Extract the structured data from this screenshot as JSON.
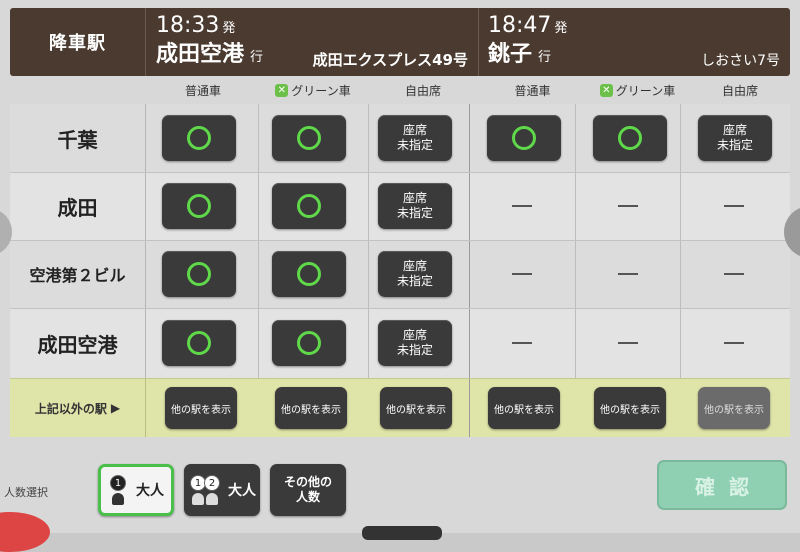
{
  "header": {
    "station_label": "降車駅",
    "train_a": {
      "time": "18:33",
      "time_suffix": "発",
      "dest": "成田空港",
      "dest_suffix": "行",
      "name": "成田エクスプレス49号"
    },
    "train_b": {
      "time": "18:47",
      "time_suffix": "発",
      "dest": "銚子",
      "dest_suffix": "行",
      "name": "しおさい7号"
    }
  },
  "classes": {
    "a": [
      "普通車",
      "グリーン車",
      "自由席"
    ],
    "b": [
      "普通車",
      "グリーン車",
      "自由席"
    ],
    "green_icon": "green-car-icon"
  },
  "stations": [
    {
      "name": "千葉",
      "a": [
        "available",
        "available",
        "unreserved"
      ],
      "b": [
        "available",
        "available",
        "unreserved"
      ]
    },
    {
      "name": "成田",
      "a": [
        "available",
        "available",
        "unreserved"
      ],
      "b": [
        "none",
        "none",
        "none"
      ]
    },
    {
      "name": "空港第２ビル",
      "a": [
        "available",
        "available",
        "unreserved"
      ],
      "b": [
        "none",
        "none",
        "none"
      ]
    },
    {
      "name": "成田空港",
      "a": [
        "available",
        "available",
        "unreserved"
      ],
      "b": [
        "none",
        "none",
        "none"
      ]
    }
  ],
  "unreserved_label_1": "座席",
  "unreserved_label_2": "未指定",
  "other_station": {
    "label": "上記以外の駅",
    "arrow": "▶",
    "button_label": "他の駅を表示"
  },
  "passengers": {
    "label": "人数選択",
    "one_adult": {
      "num": "1",
      "text": "大人"
    },
    "two_adult": {
      "num1": "1",
      "num2": "2",
      "text": "大人"
    },
    "other": {
      "line1": "その他の",
      "line2": "人数"
    }
  },
  "confirm_label": "確認",
  "colors": {
    "available_circle": "#5fd84a",
    "header_bg": "#4a3a2f",
    "other_row_bg": "#dfe4a8",
    "confirm_bg": "#8fcfb2"
  }
}
